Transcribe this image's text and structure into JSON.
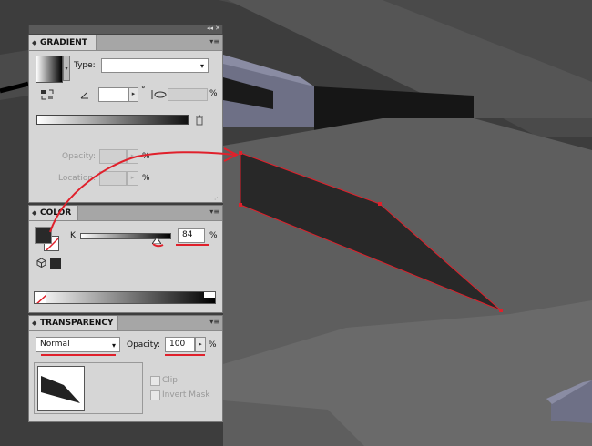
{
  "gradient_panel": {
    "title": "GRADIENT",
    "type_label": "Type:",
    "type_value": "",
    "angle_unit": "°",
    "aspect_unit": "%",
    "opacity_label": "Opacity:",
    "opacity_unit": "%",
    "location_label": "Location:",
    "location_unit": "%"
  },
  "color_panel": {
    "title": "COLOR",
    "channel_label": "K",
    "channel_value": "84",
    "channel_unit": "%",
    "slider_level": 0.84,
    "fill_color": "#292929"
  },
  "transparency_panel": {
    "title": "TRANSPARENCY",
    "blend_mode": "Normal",
    "opacity_label": "Opacity:",
    "opacity_value": "100",
    "opacity_unit": "%",
    "clip_label": "Clip",
    "invert_mask_label": "Invert Mask"
  },
  "annotation_color": "#e0202b"
}
